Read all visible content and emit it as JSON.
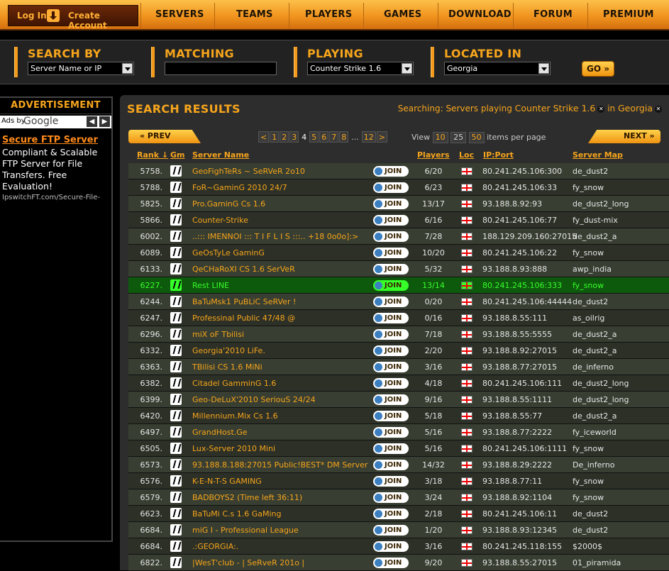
{
  "nav": {
    "login": "Log In",
    "create_account": "Create Account",
    "items": [
      "SERVERS",
      "TEAMS",
      "PLAYERS",
      "GAMES",
      "DOWNLOAD",
      "FORUM",
      "PREMIUM"
    ]
  },
  "search": {
    "search_by_label": "SEARCH BY",
    "search_by_value": "Server Name or IP",
    "matching_label": "MATCHING",
    "matching_value": "",
    "playing_label": "PLAYING",
    "playing_value": "Counter Strike 1.6",
    "located_label": "LOCATED IN",
    "located_value": "Georgia",
    "go_label": "GO »"
  },
  "ad": {
    "title": "ADVERTISEMENT",
    "ads_by": "Ads by",
    "google": "Google",
    "link": "Secure FTP Server",
    "body": "Compliant & Scalable FTP Server for File Transfers. Free Evaluation!",
    "url": "IpswitchFT.com/Secure-File-"
  },
  "results": {
    "title": "SEARCH RESULTS",
    "searching_prefix": "Searching: Servers playing",
    "searching_game": "Counter Strike 1.6",
    "searching_in": "in",
    "searching_location": "Georgia",
    "prev": "« PREV",
    "next": "NEXT »",
    "pages": [
      "<",
      "1",
      "2",
      "3",
      "4",
      "5",
      "6",
      "7",
      "8",
      "...",
      "12",
      ">"
    ],
    "current_page": "4",
    "view_label": "View",
    "per_page_options": [
      "10",
      "25",
      "50"
    ],
    "per_page_suffix": "items per page",
    "headers": {
      "rank": "Rank ↓",
      "gm": "Gm",
      "name": "Server Name",
      "players": "Players",
      "loc": "Loc",
      "ip": "IP:Port",
      "map": "Server Map"
    },
    "join_label": "JOIN",
    "rows": [
      {
        "rank": "5758.",
        "name": "GeoFighTeRs ~ SeRVeR 2o10",
        "players": "6/20",
        "ip": "80.241.245.106:300",
        "map": "de_dust2"
      },
      {
        "rank": "5788.",
        "name": "FoR~GaminG 2010 24/7",
        "players": "6/23",
        "ip": "80.241.245.106:33",
        "map": "fy_snow"
      },
      {
        "rank": "5825.",
        "name": "Pro.GaminG Cs 1.6",
        "players": "13/17",
        "ip": "93.188.8.92:93",
        "map": "de_dust2_long"
      },
      {
        "rank": "5866.",
        "name": "Counter-Strike",
        "players": "6/16",
        "ip": "80.241.245.106:77",
        "map": "fy_dust-mix"
      },
      {
        "rank": "6002.",
        "name": "..::: IMENNOI ::: T I F L I S :::.. +18 0o0o]:>",
        "players": "7/28",
        "ip": "188.129.209.160:27015",
        "map": "de_dust2_a"
      },
      {
        "rank": "6089.",
        "name": "GeOsTyLe GaminG",
        "players": "10/20",
        "ip": "80.241.245.106:22",
        "map": "fy_snow"
      },
      {
        "rank": "6133.",
        "name": "QeCHaRoXI CS 1.6 SerVeR",
        "players": "5/32",
        "ip": "93.188.8.93:888",
        "map": "awp_india"
      },
      {
        "rank": "6227.",
        "name": "Rest LINE",
        "players": "13/14",
        "ip": "80.241.245.106:333",
        "map": "fy_snow",
        "highlight": true
      },
      {
        "rank": "6244.",
        "name": "BaTuMsk1 PuBLiC SeRVer !",
        "players": "0/20",
        "ip": "80.241.245.106:44444",
        "map": "de_dust2"
      },
      {
        "rank": "6247.",
        "name": "Professinal Public 47/48 @",
        "players": "0/16",
        "ip": "93.188.8.55:111",
        "map": "as_oilrig"
      },
      {
        "rank": "6296.",
        "name": "miX oF Tbilisi",
        "players": "7/18",
        "ip": "93.188.8.55:5555",
        "map": "de_dust2_a"
      },
      {
        "rank": "6332.",
        "name": "Georgia'2010 LiFe.",
        "players": "2/20",
        "ip": "93.188.8.92:27015",
        "map": "de_dust2_a"
      },
      {
        "rank": "6363.",
        "name": "TBilisi CS 1.6 MiNi",
        "players": "3/16",
        "ip": "93.188.8.77:27015",
        "map": "de_inferno"
      },
      {
        "rank": "6382.",
        "name": "Citadel GamminG 1.6",
        "players": "4/18",
        "ip": "80.241.245.106:111",
        "map": "de_dust2_long"
      },
      {
        "rank": "6399.",
        "name": "Geo-DeLuX'2010 SeriouS 24/24",
        "players": "9/16",
        "ip": "93.188.8.55:1111",
        "map": "de_dust2_long"
      },
      {
        "rank": "6420.",
        "name": "Millennium.Mix Cs 1.6",
        "players": "5/18",
        "ip": "93.188.8.55:77",
        "map": "de_dust2_a"
      },
      {
        "rank": "6497.",
        "name": "GrandHost.Ge",
        "players": "5/16",
        "ip": "93.188.8.77:2222",
        "map": "fy_iceworld"
      },
      {
        "rank": "6505.",
        "name": "Lux-Server 2010 Mini",
        "players": "5/16",
        "ip": "80.241.245.106:1111",
        "map": "fy_snow"
      },
      {
        "rank": "6573.",
        "name": "93.188.8.188:27015 Public!BEST* DM Server",
        "players": "14/32",
        "ip": "93.188.8.29:2222",
        "map": "De_inferno"
      },
      {
        "rank": "6576.",
        "name": "K-E-N-T-S GAMING",
        "players": "3/18",
        "ip": "93.188.8.77:11",
        "map": "fy_snow"
      },
      {
        "rank": "6579.",
        "name": "BADBOYS2 (Time left 36:11)",
        "players": "3/24",
        "ip": "93.188.8.92:1104",
        "map": "fy_snow"
      },
      {
        "rank": "6623.",
        "name": "BaTuMi C.s 1.6 GaMing",
        "players": "2/18",
        "ip": "80.241.245.106:11",
        "map": "de_dust2"
      },
      {
        "rank": "6684.",
        "name": "miG I - Professional League",
        "players": "1/20",
        "ip": "93.188.8.93:12345",
        "map": "de_dust2"
      },
      {
        "rank": "6684.",
        "name": ".:GEORGIA:.",
        "players": "3/16",
        "ip": "80.241.245.118:155",
        "map": "$2000$"
      },
      {
        "rank": "6822.",
        "name": "|WesT'club - | SeRveR 201o |",
        "players": "9/20",
        "ip": "93.188.8.55:27015",
        "map": "01_piramida"
      }
    ]
  }
}
